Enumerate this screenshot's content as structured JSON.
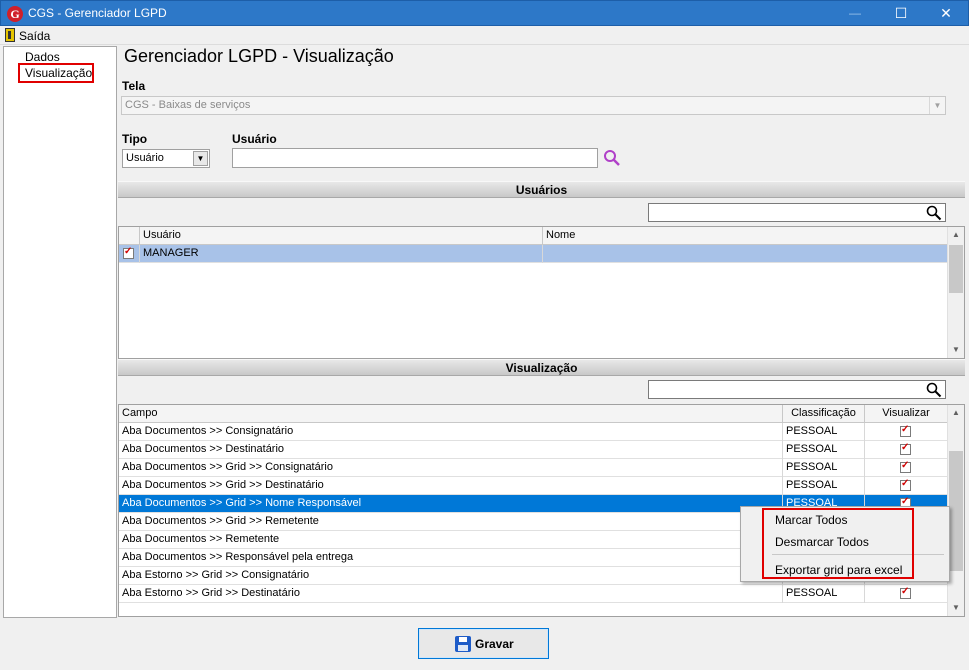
{
  "window": {
    "title": "CGS - Gerenciador LGPD",
    "minimize": "—",
    "maximize": "☐",
    "close": "✕"
  },
  "menu": {
    "exit_label": "Saída"
  },
  "nav": {
    "items": [
      {
        "label": "Dados"
      },
      {
        "label": "Visualização"
      }
    ]
  },
  "page": {
    "title": "Gerenciador LGPD - Visualização"
  },
  "form": {
    "tela_label": "Tela",
    "tela_value": "CGS - Baixas de serviços",
    "tipo_label": "Tipo",
    "tipo_value": "Usuário",
    "usuario_label": "Usuário",
    "usuario_value": ""
  },
  "users_section": {
    "title": "Usuários",
    "filter_value": "",
    "columns": [
      "Usuário",
      "Nome"
    ],
    "rows": [
      {
        "checked": true,
        "usuario": "MANAGER",
        "nome": ""
      }
    ]
  },
  "vis_section": {
    "title": "Visualização",
    "filter_value": "",
    "columns": [
      "Campo",
      "Classificação",
      "Visualizar"
    ],
    "rows": [
      {
        "campo": "Aba Documentos >> Consignatário",
        "classificacao": "PESSOAL",
        "visualizar": true
      },
      {
        "campo": "Aba Documentos >> Destinatário",
        "classificacao": "PESSOAL",
        "visualizar": true
      },
      {
        "campo": "Aba Documentos >> Grid >> Consignatário",
        "classificacao": "PESSOAL",
        "visualizar": true
      },
      {
        "campo": "Aba Documentos >> Grid >> Destinatário",
        "classificacao": "PESSOAL",
        "visualizar": true
      },
      {
        "campo": "Aba Documentos >> Grid >> Nome Responsável",
        "classificacao": "PESSOAL",
        "visualizar": true
      },
      {
        "campo": "Aba Documentos >> Grid >> Remetente",
        "classificacao": "",
        "visualizar": false
      },
      {
        "campo": "Aba Documentos >> Remetente",
        "classificacao": "",
        "visualizar": false
      },
      {
        "campo": "Aba Documentos >> Responsável pela entrega",
        "classificacao": "",
        "visualizar": false
      },
      {
        "campo": "Aba Estorno >> Grid >> Consignatário",
        "classificacao": "",
        "visualizar": false
      },
      {
        "campo": "Aba Estorno >> Grid >> Destinatário",
        "classificacao": "PESSOAL",
        "visualizar": true
      }
    ],
    "selected_index": 4
  },
  "context_menu": {
    "items": [
      "Marcar Todos",
      "Desmarcar Todos",
      "Exportar grid para excel"
    ]
  },
  "footer": {
    "save_label": "Gravar"
  }
}
